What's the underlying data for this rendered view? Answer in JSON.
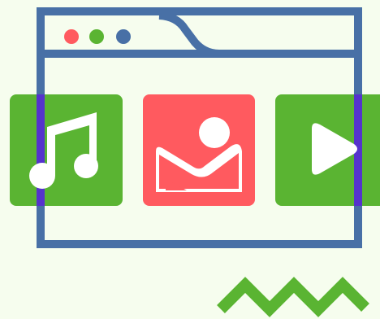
{
  "scene": {
    "name": "media-browser-illustration",
    "colors": {
      "background": "#f6fdee",
      "window_frame": "#4870a6",
      "window_panel": "#f6fdee",
      "dot_red": "#ff5a5f",
      "dot_green": "#5ab432",
      "dot_blue": "#4870a6",
      "tile_music": "#5ab432",
      "tile_image": "#ff5a5f",
      "tile_video": "#5ab432",
      "overlap": "#5533cc",
      "icon_fill": "#ffffff",
      "zigzag": "#5ab432"
    },
    "window_controls": [
      "close-dot",
      "minimize-dot",
      "maximize-dot"
    ],
    "tiles": [
      {
        "id": "music",
        "icon": "music-note-icon"
      },
      {
        "id": "image",
        "icon": "image-icon"
      },
      {
        "id": "video",
        "icon": "play-icon"
      }
    ],
    "decoration": {
      "icon": "zigzag-icon"
    }
  }
}
